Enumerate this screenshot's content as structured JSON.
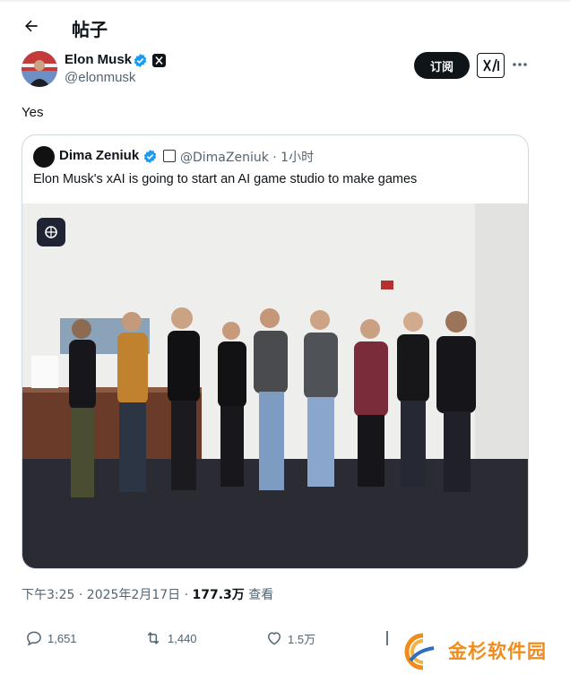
{
  "header": {
    "title": "帖子"
  },
  "post": {
    "author_name": "Elon Musk",
    "author_handle": "@elonmusk",
    "subscribe_label": "订阅",
    "text": "Yes",
    "timestamp": "下午3:25 · 2025年2月17日 · ",
    "views_count": "177.3万",
    "views_label": " 查看"
  },
  "quote": {
    "author_name": "Dima Zeniuk",
    "meta": "@DimaZeniuk · 1小时",
    "text": "Elon Musk's xAI is going to start an AI game studio to make games"
  },
  "actions": {
    "reply_count": "1,651",
    "retweet_count": "1,440",
    "like_count": "1.5万"
  },
  "watermark": {
    "text": "金杉软件园"
  },
  "colors": {
    "text": "#0f1419",
    "secondary": "#536471",
    "verified": "#1d9bf0",
    "border": "#cfd9de",
    "watermark": "#f08c1d"
  }
}
